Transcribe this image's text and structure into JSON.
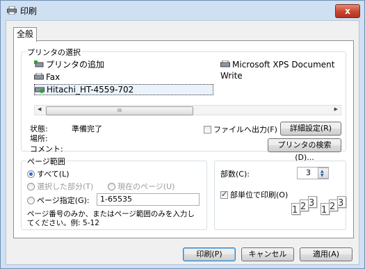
{
  "window": {
    "title": "印刷",
    "close_label": "x"
  },
  "tab": {
    "label": "全般"
  },
  "printer_group": {
    "label": "プリンタの選択",
    "items": [
      {
        "label": "プリンタの追加"
      },
      {
        "label": "Fax"
      },
      {
        "label": "Hitachi_HT-4559-702"
      },
      {
        "label": "Microsoft XPS Document Write"
      }
    ],
    "selected_index": 2,
    "scroll_thumb": "III"
  },
  "status": {
    "state_label": "状態:",
    "state_value": "準備完了",
    "location_label": "場所:",
    "comment_label": "コメント:"
  },
  "print_to_file": {
    "label": "ファイルへ出力(F)",
    "checked": false
  },
  "buttons": {
    "preferences": "詳細設定(R)",
    "find_printer": "プリンタの検索(D)...",
    "print": "印刷(P)",
    "cancel": "キャンセル",
    "apply": "適用(A)"
  },
  "page_range": {
    "label": "ページ範囲",
    "all": "すべて(L)",
    "selection": "選択した部分(T)",
    "current": "現在のページ(U)",
    "pages": "ページ指定(G):",
    "pages_value": "1-65535",
    "help_line1": "ページ番号のみか、またはページ範囲のみを入力し",
    "help_line2": "てください。例: 5-12",
    "selected": "all"
  },
  "copies": {
    "label": "部数(C):",
    "value": "3",
    "collate_label": "部単位で印刷(O)",
    "collate_checked": true,
    "collate_pages": [
      "1",
      "2",
      "3",
      "1",
      "2",
      "3"
    ]
  },
  "colors": {
    "accent": "#2a6fc9",
    "close": "#c8452d"
  }
}
